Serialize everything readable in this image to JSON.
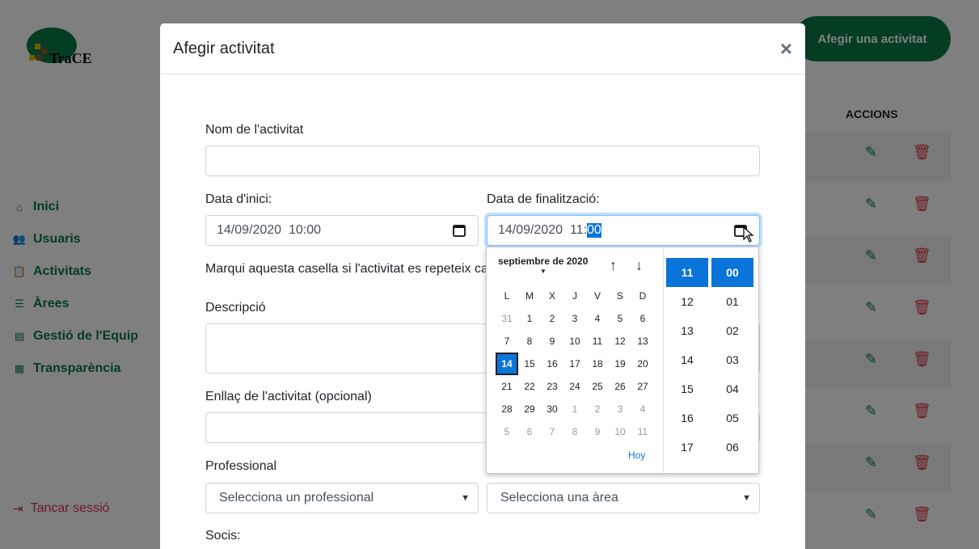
{
  "sidebar": {
    "logo_text": "TraCE",
    "nav": [
      {
        "label": "Inici",
        "icon": "home-icon"
      },
      {
        "label": "Usuaris",
        "icon": "users-icon"
      },
      {
        "label": "Activitats",
        "icon": "clipboard-icon"
      },
      {
        "label": "Àrees",
        "icon": "list-icon"
      },
      {
        "label": "Gestió de l'Equip",
        "icon": "id-card-icon"
      },
      {
        "label": "Transparència",
        "icon": "document-icon"
      }
    ],
    "logout": "Tancar sessió"
  },
  "main": {
    "add_button": "Afegir una activitat",
    "table_header_actions": "ACCIONS"
  },
  "modal": {
    "title": "Afegir activitat",
    "close": "×",
    "name_label": "Nom de l'activitat",
    "start_label": "Data d'inici:",
    "start_value": "14/09/2020  10:00",
    "end_label": "Data de finalització:",
    "end_value_prefix": "14/09/2020  11:",
    "end_value_selected": "00",
    "repeat_text": "Marqui aquesta casella si l'activitat es repeteix cad",
    "description_label": "Descripció",
    "link_label": "Enllaç de l'activitat (opcional)",
    "professional_label": "Professional",
    "professional_select": "Selecciona un professional",
    "area_select": "Selecciona una àrea",
    "socis_label": "Socis:"
  },
  "datepicker": {
    "month": "septiembre de 2020",
    "weekdays": [
      "L",
      "M",
      "X",
      "J",
      "V",
      "S",
      "D"
    ],
    "weeks": [
      [
        "31",
        "1",
        "2",
        "3",
        "4",
        "5",
        "6"
      ],
      [
        "7",
        "8",
        "9",
        "10",
        "11",
        "12",
        "13"
      ],
      [
        "14",
        "15",
        "16",
        "17",
        "18",
        "19",
        "20"
      ],
      [
        "21",
        "22",
        "23",
        "24",
        "25",
        "26",
        "27"
      ],
      [
        "28",
        "29",
        "30",
        "1",
        "2",
        "3",
        "4"
      ],
      [
        "5",
        "6",
        "7",
        "8",
        "9",
        "10",
        "11"
      ]
    ],
    "selected_day": "14",
    "today_label": "Hoy",
    "hours": [
      "11",
      "12",
      "13",
      "14",
      "15",
      "16",
      "17"
    ],
    "minutes": [
      "00",
      "01",
      "02",
      "03",
      "04",
      "05",
      "06"
    ],
    "selected_hour": "11",
    "selected_minute": "00"
  },
  "colors": {
    "brand_green": "#0a7a46",
    "danger_red": "#dc3545",
    "picker_blue": "#0a74da"
  }
}
